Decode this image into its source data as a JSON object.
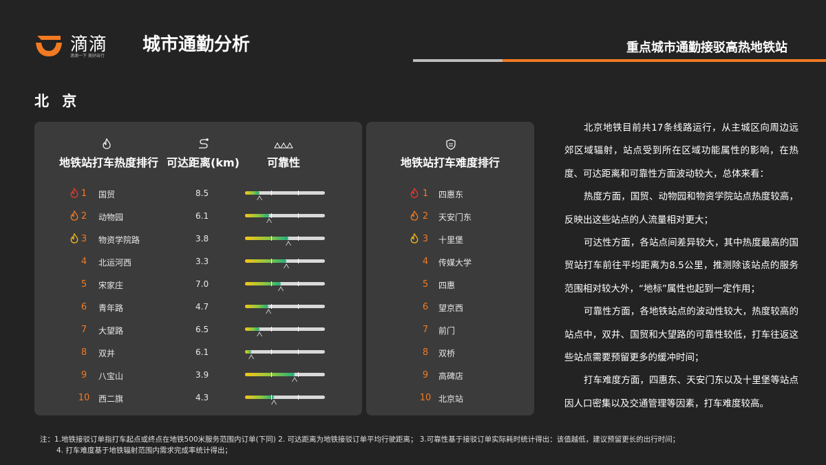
{
  "header": {
    "logo_text": "滴滴",
    "logo_slogan": "滴滴一下 美好出行",
    "page_title": "城市通勤分析",
    "section_title": "重点城市通勤接驳高热地铁站",
    "accent_color": "#f27a22"
  },
  "city": "北 京",
  "heat_panel": {
    "col_station": "地铁站打车热度排行",
    "col_distance": "可达距离(km)",
    "col_reliability": "可靠性",
    "icons": [
      "flame-outline-icon",
      "route-icon",
      "mountain-icon"
    ],
    "rows": [
      {
        "rank": "1",
        "flame": "red",
        "name": "国贸",
        "distance": "8.5",
        "reliability": 0.18
      },
      {
        "rank": "2",
        "flame": "orange",
        "name": "动物园",
        "distance": "6.1",
        "reliability": 0.3
      },
      {
        "rank": "3",
        "flame": "yellow",
        "name": "物资学院路",
        "distance": "3.8",
        "reliability": 0.54
      },
      {
        "rank": "4",
        "flame": "",
        "name": "北运河西",
        "distance": "3.3",
        "reliability": 0.52
      },
      {
        "rank": "5",
        "flame": "",
        "name": "宋家庄",
        "distance": "7.0",
        "reliability": 0.45
      },
      {
        "rank": "6",
        "flame": "",
        "name": "青年路",
        "distance": "4.7",
        "reliability": 0.29
      },
      {
        "rank": "7",
        "flame": "",
        "name": "大望路",
        "distance": "6.5",
        "reliability": 0.18
      },
      {
        "rank": "8",
        "flame": "",
        "name": "双井",
        "distance": "6.1",
        "reliability": 0.08
      },
      {
        "rank": "9",
        "flame": "",
        "name": "八宝山",
        "distance": "3.9",
        "reliability": 0.62
      },
      {
        "rank": "10",
        "flame": "",
        "name": "西二旗",
        "distance": "4.3",
        "reliability": 0.36
      }
    ]
  },
  "difficulty_panel": {
    "title": "地铁站打车难度排行",
    "icon": "shield-icon",
    "rows": [
      {
        "rank": "1",
        "flame": "red",
        "name": "四惠东"
      },
      {
        "rank": "2",
        "flame": "orange",
        "name": "天安门东"
      },
      {
        "rank": "3",
        "flame": "yellow",
        "name": "十里堡"
      },
      {
        "rank": "4",
        "flame": "",
        "name": "传媒大学"
      },
      {
        "rank": "5",
        "flame": "",
        "name": "四惠"
      },
      {
        "rank": "6",
        "flame": "",
        "name": "望京西"
      },
      {
        "rank": "7",
        "flame": "",
        "name": "前门"
      },
      {
        "rank": "8",
        "flame": "",
        "name": "双桥"
      },
      {
        "rank": "9",
        "flame": "",
        "name": "高碑店"
      },
      {
        "rank": "10",
        "flame": "",
        "name": "北京站"
      }
    ]
  },
  "description": [
    "北京地铁目前共17条线路运行，从主城区向周边远郊区域辐射，站点受到所在区域功能属性的影响，在热度、可达距离和可靠性方面波动较大，总体来看：",
    "热度方面，国贸、动物园和物资学院站点热度较高，反映出这些站点的人流量相对更大；",
    "可达性方面，各站点间差异较大，其中热度最高的国贸站打车前往平均距离为8.5公里，推测除该站点的服务范围相对较大外，“地标”属性也起到一定作用；",
    "可靠性方面，各地铁站点的波动性较大，热度较高的站点中，双井、国贸和大望路的可靠性较低，打车往返这些站点需要预留更多的缓冲时间；",
    "打车难度方面，四惠东、天安门东以及十里堡等站点因人口密集以及交通管理等因素，打车难度较高。"
  ],
  "notes": {
    "line1": "注：1.地铁接驳订单指打车起点或终点在地铁500米服务范围内订单(下同)     2. 可达距离为地铁接驳订单平均行驶距离；     3.可靠性基于接驳订单实际耗时统计得出：该值越低，建议预留更长的出行时间；",
    "line2": "4. 打车难度基于地铁辐射范围内需求完成率统计得出；"
  }
}
